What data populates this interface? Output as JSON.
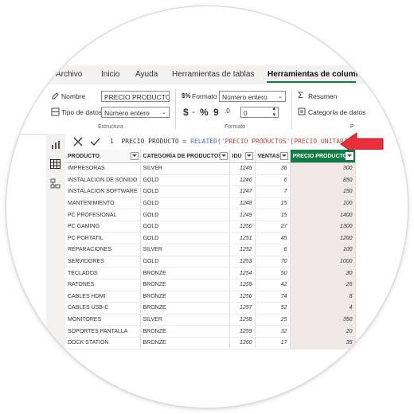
{
  "tabs": [
    {
      "label": "Archivo"
    },
    {
      "label": "Inicio"
    },
    {
      "label": "Ayuda"
    },
    {
      "label": "Herramientas de tablas"
    },
    {
      "label": "Herramientas de columnas"
    }
  ],
  "ribbon": {
    "nombre_label": "Nombre",
    "nombre_value": "PRECIO PRODUCTO",
    "tipo_label": "Tipo de datos",
    "tipo_value": "Número entero",
    "estructura_group": "Estructura",
    "formato_label": "Formato",
    "formato_value": "Número entero",
    "currency_symbol": "$",
    "percent_symbol": "%",
    "comma_symbol": "9",
    "decimals_value": "0",
    "formato_group": "Formato",
    "resumen_label": "Resumen",
    "categoria_label": "Categoría de datos",
    "partial_group": "P"
  },
  "formula": {
    "line_number": "1",
    "part1": "PRECIO PRODUCTO = ",
    "function": "RELATED",
    "part2": "('PRECIO PRODUCTOS'[PRECIO UNITARIO])"
  },
  "colors": {
    "accent": "#107c41",
    "arrow": "#e8303a"
  },
  "table": {
    "headers": [
      "PRODUCTO",
      "CATEGORÍA DE PRODUCTOS",
      "IDU",
      "VENTAS",
      "PRECIO PRODUCTO"
    ],
    "rows": [
      [
        "IMPRESORAS",
        "SILVER",
        "1245",
        "36",
        "300"
      ],
      [
        "INSTALACION DE SONIDO",
        "GOLD",
        "1246",
        "6",
        "850"
      ],
      [
        "INSTALACION SOFTWARE",
        "GOLD",
        "1247",
        "7",
        "150"
      ],
      [
        "MANTENIMIENTO",
        "GOLD",
        "1248",
        "15",
        "100"
      ],
      [
        "PC PROFESIONAL",
        "GOLD",
        "1249",
        "15",
        "1400"
      ],
      [
        "PC GAMING",
        "GOLD",
        "1250",
        "27",
        "1300"
      ],
      [
        "PC PORTATIL",
        "GOLD",
        "1251",
        "45",
        "1200"
      ],
      [
        "REPARACIONES",
        "SILVER",
        "1252",
        "6",
        "100"
      ],
      [
        "SERVIDORES",
        "GOLD",
        "1253",
        "70",
        "1000"
      ],
      [
        "TECLADOS",
        "BRONZE",
        "1254",
        "50",
        "30"
      ],
      [
        "RATONES",
        "BRONZE",
        "1255",
        "42",
        "25"
      ],
      [
        "CABLES HDMI",
        "BRONZE",
        "1256",
        "74",
        "8"
      ],
      [
        "CABLES USB-C",
        "BRONZE",
        "1257",
        "52",
        "4"
      ],
      [
        "MONITORES",
        "SILVER",
        "1258",
        "25",
        "350"
      ],
      [
        "SOPORTES PANTALLA",
        "BRONZE",
        "1259",
        "32",
        "20"
      ],
      [
        "DOCK STATION",
        "BRONZE",
        "1260",
        "17",
        "35"
      ]
    ]
  }
}
